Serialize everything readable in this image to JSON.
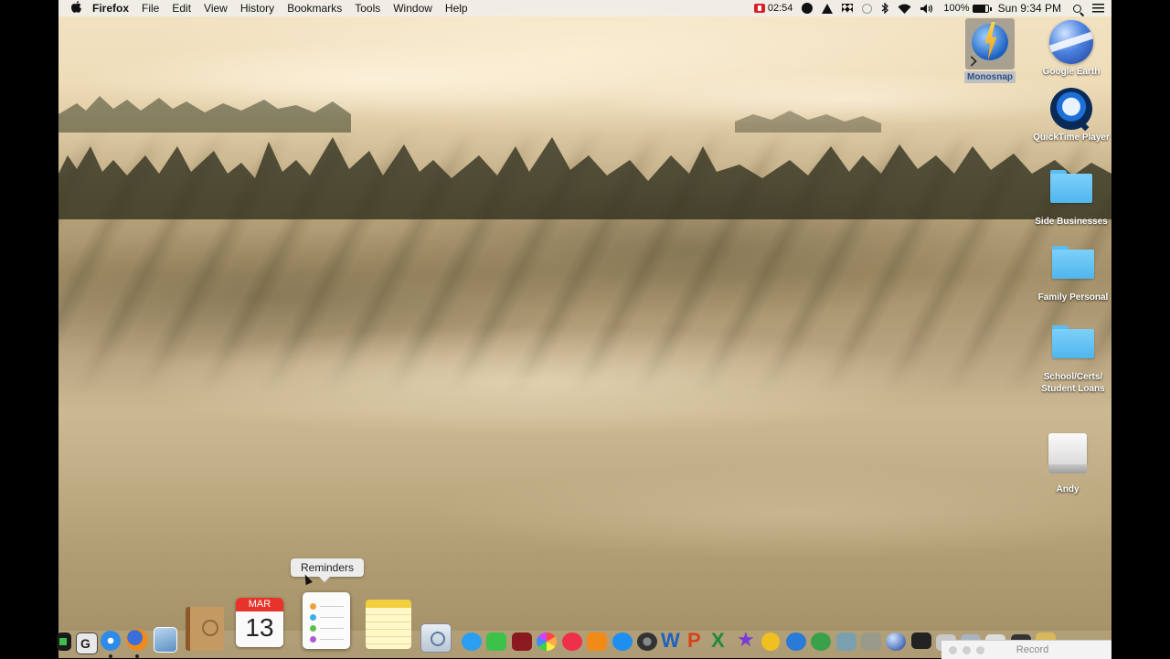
{
  "menubar": {
    "app_name": "Firefox",
    "items": [
      "File",
      "Edit",
      "View",
      "History",
      "Bookmarks",
      "Tools",
      "Window",
      "Help"
    ],
    "status": {
      "recording_time": "02:54",
      "battery_percent": "100%",
      "clock": "Sun 9:34 PM"
    },
    "icons": [
      "apple-icon",
      "record-icon",
      "monosnap-bolt-icon",
      "google-drive-icon",
      "dropbox-icon",
      "time-machine-icon",
      "bluetooth-icon",
      "wifi-icon",
      "volume-icon",
      "battery-icon",
      "spotlight-search-icon",
      "notification-center-icon"
    ]
  },
  "desktop": {
    "icons": [
      {
        "label": "Monosnap",
        "type": "app-alias",
        "selected": true
      },
      {
        "label": "Google Earth",
        "type": "app"
      },
      {
        "label": "QuickTime Player",
        "type": "app-alias"
      },
      {
        "label": "Side Businesses",
        "type": "folder"
      },
      {
        "label": "Family Personal",
        "type": "folder"
      },
      {
        "label": "School/Certs/ Student Loans",
        "type": "folder"
      },
      {
        "label": "Andy",
        "type": "drive"
      }
    ]
  },
  "tooltip": {
    "text": "Reminders"
  },
  "dock": {
    "calendar": {
      "month": "MAR",
      "day": "13"
    },
    "apps": [
      "Activity Monitor",
      "Grab",
      "Safari",
      "Firefox",
      "Preview",
      "Contacts",
      "Calendar",
      "Reminders",
      "Notes",
      "Image Capture",
      "Messages",
      "FaceTime",
      "Photo Booth",
      "Photos",
      "iTunes",
      "iBooks",
      "App Store",
      "System Preferences",
      "Word",
      "PowerPoint",
      "Excel",
      "iMovie",
      "Outlook",
      "Lync",
      "Network Utility",
      "Gimp",
      "Google Earth",
      "Monitor",
      "Keka",
      "Archive",
      "Finder",
      "Terminal",
      "Trash"
    ],
    "colors": {
      "accent": "#1b7bd6"
    }
  },
  "record_window": {
    "title": "Record"
  }
}
